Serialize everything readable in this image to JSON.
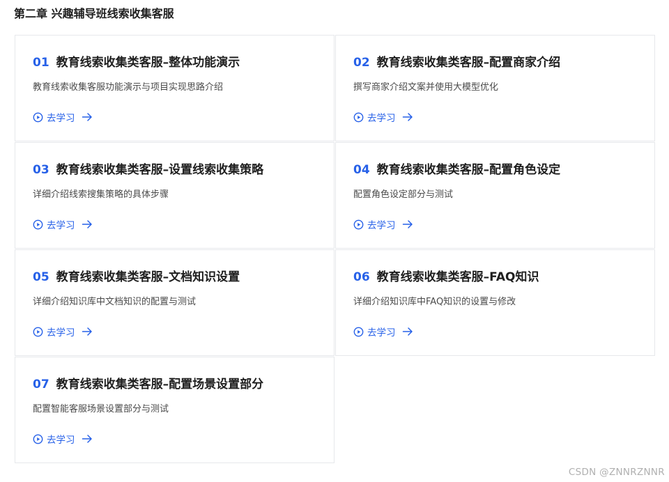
{
  "chapter": {
    "title": "第二章 兴趣辅导班线索收集客服"
  },
  "action_label": "去学习",
  "accent_color": "#2761e8",
  "cards": [
    {
      "num": "01",
      "title": "教育线索收集类客服–整体功能演示",
      "desc": "教育线索收集客服功能演示与项目实现思路介绍"
    },
    {
      "num": "02",
      "title": "教育线索收集类客服–配置商家介绍",
      "desc": "撰写商家介绍文案并使用大模型优化"
    },
    {
      "num": "03",
      "title": "教育线索收集类客服–设置线索收集策略",
      "desc": "详细介绍线索搜集策略的具体步骤"
    },
    {
      "num": "04",
      "title": "教育线索收集类客服–配置角色设定",
      "desc": "配置角色设定部分与测试"
    },
    {
      "num": "05",
      "title": "教育线索收集类客服–文档知识设置",
      "desc": "详细介绍知识库中文档知识的配置与测试"
    },
    {
      "num": "06",
      "title": "教育线索收集类客服–FAQ知识",
      "desc": "详细介绍知识库中FAQ知识的设置与修改"
    },
    {
      "num": "07",
      "title": "教育线索收集类客服–配置场景设置部分",
      "desc": "配置智能客服场景设置部分与测试"
    }
  ],
  "watermark": "CSDN @ZNNRZNNR"
}
